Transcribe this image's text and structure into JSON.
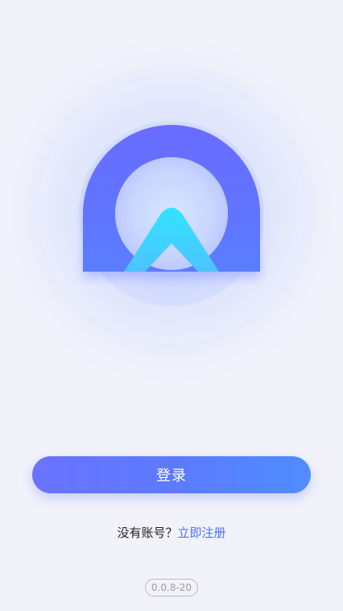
{
  "login": {
    "button_label": "登录"
  },
  "register": {
    "prompt": "没有账号？",
    "link_label": "立即注册"
  },
  "version": {
    "label": "0.0.8-20"
  },
  "colors": {
    "background": "#f1f2fa",
    "primary": "#5b7bff",
    "primary_start": "#6a73ff",
    "primary_end": "#4f8dff",
    "link": "#4f6fff",
    "logo_arch": "#6272ff",
    "logo_chevron": "#3fe0ff"
  },
  "icons": {
    "app_logo": "app-logo-icon"
  }
}
